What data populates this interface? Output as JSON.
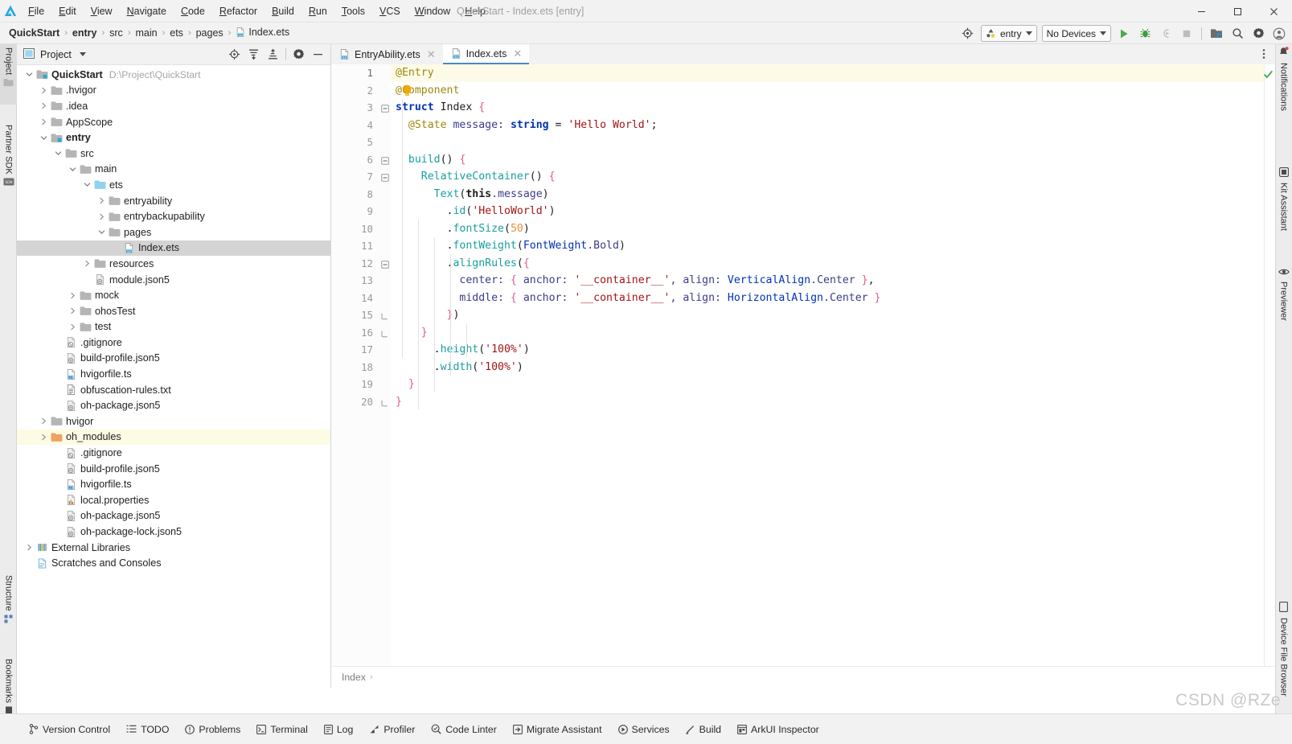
{
  "window": {
    "title": "QuickStart - Index.ets [entry]",
    "minimize": "–",
    "maximize": "☐",
    "close": "✕"
  },
  "menu": {
    "items": [
      "File",
      "Edit",
      "View",
      "Navigate",
      "Code",
      "Refactor",
      "Build",
      "Run",
      "Tools",
      "VCS",
      "Window",
      "Help"
    ]
  },
  "breadcrumb": {
    "items": [
      "QuickStart",
      "entry",
      "src",
      "main",
      "ets",
      "pages",
      "Index.ets"
    ],
    "separator": "›"
  },
  "toolbar": {
    "target_label": "entry",
    "device_label": "No Devices",
    "run_title": "Run",
    "debug_title": "Debug",
    "attach_title": "Attach",
    "stop_title": "Stop",
    "previewer_title": "Previewer",
    "search_title": "Search",
    "settings_title": "Settings",
    "account_title": "Account",
    "select_target_title": "Select Run/Debug Target"
  },
  "left_strip": {
    "tabs": [
      {
        "label": "Project",
        "icon": "folder-icon",
        "selected": true
      },
      {
        "label": "Partner SDK",
        "icon": "sdk-icon",
        "selected": false
      },
      {
        "label": "Structure",
        "icon": "structure-icon",
        "selected": false
      },
      {
        "label": "Bookmarks",
        "icon": "bookmark-icon",
        "selected": false
      }
    ]
  },
  "right_strip": {
    "tabs": [
      {
        "label": "Notifications",
        "icon": "bell-icon"
      },
      {
        "label": "Kit Assistant",
        "icon": "kit-icon"
      },
      {
        "label": "Previewer",
        "icon": "eye-icon"
      },
      {
        "label": "Device File Browser",
        "icon": "device-icon"
      }
    ]
  },
  "project_panel": {
    "title": "Project",
    "actions": [
      "locate-icon",
      "expand-all-icon",
      "collapse-all-icon",
      "settings-icon",
      "hide-icon"
    ],
    "root": {
      "label": "QuickStart",
      "path": "D:\\Project\\QuickStart"
    },
    "tree": [
      {
        "label": "QuickStart",
        "path": "D:\\Project\\QuickStart",
        "depth": 0,
        "icon": "module-folder",
        "arrow": "down",
        "bold": true
      },
      {
        "label": ".hvigor",
        "depth": 1,
        "icon": "folder",
        "arrow": "right"
      },
      {
        "label": ".idea",
        "depth": 1,
        "icon": "folder",
        "arrow": "right"
      },
      {
        "label": "AppScope",
        "depth": 1,
        "icon": "folder",
        "arrow": "right"
      },
      {
        "label": "entry",
        "depth": 1,
        "icon": "module-folder",
        "arrow": "down",
        "bold": true
      },
      {
        "label": "src",
        "depth": 2,
        "icon": "folder",
        "arrow": "down"
      },
      {
        "label": "main",
        "depth": 3,
        "icon": "folder",
        "arrow": "down"
      },
      {
        "label": "ets",
        "depth": 4,
        "icon": "source-folder",
        "arrow": "down"
      },
      {
        "label": "entryability",
        "depth": 5,
        "icon": "folder",
        "arrow": "right"
      },
      {
        "label": "entrybackupability",
        "depth": 5,
        "icon": "folder",
        "arrow": "right"
      },
      {
        "label": "pages",
        "depth": 5,
        "icon": "folder",
        "arrow": "down"
      },
      {
        "label": "Index.ets",
        "depth": 6,
        "icon": "ets-file",
        "arrow": "none",
        "selected": true
      },
      {
        "label": "resources",
        "depth": 4,
        "icon": "folder",
        "arrow": "right"
      },
      {
        "label": "module.json5",
        "depth": 4,
        "icon": "json-file",
        "arrow": "none"
      },
      {
        "label": "mock",
        "depth": 3,
        "icon": "folder",
        "arrow": "right"
      },
      {
        "label": "ohosTest",
        "depth": 3,
        "icon": "folder",
        "arrow": "right"
      },
      {
        "label": "test",
        "depth": 3,
        "icon": "folder",
        "arrow": "right"
      },
      {
        "label": ".gitignore",
        "depth": 2,
        "icon": "git-file",
        "arrow": "none"
      },
      {
        "label": "build-profile.json5",
        "depth": 2,
        "icon": "json-file",
        "arrow": "none"
      },
      {
        "label": "hvigorfile.ts",
        "depth": 2,
        "icon": "ts-file",
        "arrow": "none"
      },
      {
        "label": "obfuscation-rules.txt",
        "depth": 2,
        "icon": "txt-file",
        "arrow": "none"
      },
      {
        "label": "oh-package.json5",
        "depth": 2,
        "icon": "json-file",
        "arrow": "none"
      },
      {
        "label": "hvigor",
        "depth": 1,
        "icon": "folder",
        "arrow": "right"
      },
      {
        "label": "oh_modules",
        "depth": 1,
        "icon": "orange-folder",
        "arrow": "right",
        "highlight": true
      },
      {
        "label": ".gitignore",
        "depth": 2,
        "icon": "git-file",
        "arrow": "none"
      },
      {
        "label": "build-profile.json5",
        "depth": 2,
        "icon": "json-file",
        "arrow": "none"
      },
      {
        "label": "hvigorfile.ts",
        "depth": 2,
        "icon": "ts-file",
        "arrow": "none"
      },
      {
        "label": "local.properties",
        "depth": 2,
        "icon": "props-file",
        "arrow": "none"
      },
      {
        "label": "oh-package.json5",
        "depth": 2,
        "icon": "json-file",
        "arrow": "none"
      },
      {
        "label": "oh-package-lock.json5",
        "depth": 2,
        "icon": "json-file",
        "arrow": "none"
      },
      {
        "label": "External Libraries",
        "depth": 0,
        "icon": "libraries",
        "arrow": "right"
      },
      {
        "label": "Scratches and Consoles",
        "depth": 0,
        "icon": "scratches",
        "arrow": "none"
      }
    ]
  },
  "editor": {
    "tabs": [
      {
        "label": "EntryAbility.ets",
        "icon": "ets-file",
        "active": false,
        "close": "✕"
      },
      {
        "label": "Index.ets",
        "icon": "ets-file",
        "active": true,
        "close": "✕"
      }
    ],
    "more_title": "More options",
    "current_line": 1,
    "line_count": 20,
    "inspection_status": "ok",
    "breadcrumb": {
      "items": [
        "Index"
      ],
      "separator": "›"
    },
    "lines": [
      {
        "n": 1,
        "fold": "",
        "tokens": [
          {
            "t": "@Entry",
            "c": "tk-ann"
          }
        ]
      },
      {
        "n": 2,
        "fold": "",
        "tokens": [
          {
            "t": "@",
            "c": "tk-ann"
          },
          {
            "t": "C",
            "c": "tk-ann bulbchar"
          },
          {
            "t": "omponent",
            "c": "tk-ann"
          }
        ]
      },
      {
        "n": 3,
        "fold": "minus",
        "tokens": [
          {
            "t": "struct ",
            "c": "tk-kw"
          },
          {
            "t": "Index ",
            "c": "tk-id"
          },
          {
            "t": "{",
            "c": "tk-brace"
          }
        ]
      },
      {
        "n": 4,
        "fold": "",
        "tokens": [
          {
            "t": "  ",
            "c": ""
          },
          {
            "t": "@State",
            "c": "tk-ann"
          },
          {
            "t": " message: ",
            "c": "tk-prop"
          },
          {
            "t": "string",
            "c": "tk-kw"
          },
          {
            "t": " = ",
            "c": "tk-pl"
          },
          {
            "t": "'Hello World'",
            "c": "tk-str"
          },
          {
            "t": ";",
            "c": "tk-pl"
          }
        ]
      },
      {
        "n": 5,
        "fold": "",
        "tokens": []
      },
      {
        "n": 6,
        "fold": "minus",
        "tokens": [
          {
            "t": "  ",
            "c": ""
          },
          {
            "t": "build",
            "c": "tk-fn"
          },
          {
            "t": "()",
            "c": "tk-pl"
          },
          {
            "t": " ",
            "c": ""
          },
          {
            "t": "{",
            "c": "tk-brace"
          }
        ]
      },
      {
        "n": 7,
        "fold": "minus",
        "tokens": [
          {
            "t": "    ",
            "c": ""
          },
          {
            "t": "RelativeContainer",
            "c": "tk-fn"
          },
          {
            "t": "()",
            "c": "tk-pl"
          },
          {
            "t": " ",
            "c": ""
          },
          {
            "t": "{",
            "c": "tk-brace"
          }
        ]
      },
      {
        "n": 8,
        "fold": "",
        "tokens": [
          {
            "t": "      ",
            "c": ""
          },
          {
            "t": "Text",
            "c": "tk-fn"
          },
          {
            "t": "(",
            "c": "tk-pl"
          },
          {
            "t": "this",
            "c": "tk-this"
          },
          {
            "t": ".message",
            "c": "tk-mem"
          },
          {
            "t": ")",
            "c": "tk-pl"
          }
        ]
      },
      {
        "n": 9,
        "fold": "",
        "tokens": [
          {
            "t": "        .",
            "c": "tk-pl"
          },
          {
            "t": "id",
            "c": "tk-fn"
          },
          {
            "t": "(",
            "c": "tk-pl"
          },
          {
            "t": "'HelloWorld'",
            "c": "tk-str"
          },
          {
            "t": ")",
            "c": "tk-pl"
          }
        ]
      },
      {
        "n": 10,
        "fold": "",
        "tokens": [
          {
            "t": "        .",
            "c": "tk-pl"
          },
          {
            "t": "fontSize",
            "c": "tk-fn"
          },
          {
            "t": "(",
            "c": "tk-pl"
          },
          {
            "t": "50",
            "c": "tk-num"
          },
          {
            "t": ")",
            "c": "tk-pl"
          }
        ]
      },
      {
        "n": 11,
        "fold": "",
        "tokens": [
          {
            "t": "        .",
            "c": "tk-pl"
          },
          {
            "t": "fontWeight",
            "c": "tk-fn"
          },
          {
            "t": "(",
            "c": "tk-pl"
          },
          {
            "t": "FontWeight",
            "c": "tk-type"
          },
          {
            "t": ".Bold",
            "c": "tk-mem"
          },
          {
            "t": ")",
            "c": "tk-pl"
          }
        ]
      },
      {
        "n": 12,
        "fold": "minus",
        "tokens": [
          {
            "t": "        .",
            "c": "tk-pl"
          },
          {
            "t": "alignRules",
            "c": "tk-fn"
          },
          {
            "t": "(",
            "c": "tk-pl"
          },
          {
            "t": "{",
            "c": "tk-brace"
          }
        ]
      },
      {
        "n": 13,
        "fold": "",
        "tokens": [
          {
            "t": "          center: ",
            "c": "tk-prop"
          },
          {
            "t": "{",
            "c": "tk-brace"
          },
          {
            "t": " anchor: ",
            "c": "tk-prop"
          },
          {
            "t": "'__container__'",
            "c": "tk-str"
          },
          {
            "t": ", align: ",
            "c": "tk-prop"
          },
          {
            "t": "VerticalAlign",
            "c": "tk-type"
          },
          {
            "t": ".Center ",
            "c": "tk-mem"
          },
          {
            "t": "}",
            "c": "tk-brace"
          },
          {
            "t": ",",
            "c": "tk-pl"
          }
        ]
      },
      {
        "n": 14,
        "fold": "",
        "tokens": [
          {
            "t": "          middle: ",
            "c": "tk-prop"
          },
          {
            "t": "{",
            "c": "tk-brace"
          },
          {
            "t": " anchor: ",
            "c": "tk-prop"
          },
          {
            "t": "'__container__'",
            "c": "tk-str"
          },
          {
            "t": ", align: ",
            "c": "tk-prop"
          },
          {
            "t": "HorizontalAlign",
            "c": "tk-type"
          },
          {
            "t": ".Center ",
            "c": "tk-mem"
          },
          {
            "t": "}",
            "c": "tk-brace"
          }
        ]
      },
      {
        "n": 15,
        "fold": "plus",
        "tokens": [
          {
            "t": "        ",
            "c": ""
          },
          {
            "t": "}",
            "c": "tk-brace"
          },
          {
            "t": ")",
            "c": "tk-pl"
          }
        ]
      },
      {
        "n": 16,
        "fold": "plus",
        "tokens": [
          {
            "t": "    ",
            "c": ""
          },
          {
            "t": "}",
            "c": "tk-brace"
          }
        ]
      },
      {
        "n": 17,
        "fold": "",
        "tokens": [
          {
            "t": "      .",
            "c": "tk-pl"
          },
          {
            "t": "height",
            "c": "tk-fn"
          },
          {
            "t": "(",
            "c": "tk-pl"
          },
          {
            "t": "'100%'",
            "c": "tk-str"
          },
          {
            "t": ")",
            "c": "tk-pl"
          }
        ]
      },
      {
        "n": 18,
        "fold": "",
        "tokens": [
          {
            "t": "      .",
            "c": "tk-pl"
          },
          {
            "t": "width",
            "c": "tk-fn"
          },
          {
            "t": "(",
            "c": "tk-pl"
          },
          {
            "t": "'100%'",
            "c": "tk-str"
          },
          {
            "t": ")",
            "c": "tk-pl"
          }
        ]
      },
      {
        "n": 19,
        "fold": "",
        "tokens": [
          {
            "t": "  ",
            "c": ""
          },
          {
            "t": "}",
            "c": "tk-brace"
          }
        ]
      },
      {
        "n": 20,
        "fold": "plus",
        "tokens": [
          {
            "t": "}",
            "c": "tk-brace"
          }
        ]
      }
    ]
  },
  "statusbar": {
    "items": [
      {
        "label": "Version Control",
        "icon": "branch-icon"
      },
      {
        "label": "TODO",
        "icon": "todo-icon"
      },
      {
        "label": "Problems",
        "icon": "problems-icon"
      },
      {
        "label": "Terminal",
        "icon": "terminal-icon"
      },
      {
        "label": "Log",
        "icon": "log-icon"
      },
      {
        "label": "Profiler",
        "icon": "profiler-icon"
      },
      {
        "label": "Code Linter",
        "icon": "linter-icon"
      },
      {
        "label": "Migrate Assistant",
        "icon": "migrate-icon"
      },
      {
        "label": "Services",
        "icon": "services-icon"
      },
      {
        "label": "Build",
        "icon": "build-icon"
      },
      {
        "label": "ArkUI Inspector",
        "icon": "inspector-icon"
      }
    ]
  },
  "watermark": {
    "text": "CSDN @RZe"
  },
  "colors": {
    "accent": "#4a88c7",
    "run_green": "#4fa84f",
    "highlight_row": "#fdfbe4",
    "selected_row": "#d4d4d4",
    "folder_blue": "#8fd3ef",
    "folder_orange": "#f0a35e",
    "ok_check": "#4caf50"
  }
}
